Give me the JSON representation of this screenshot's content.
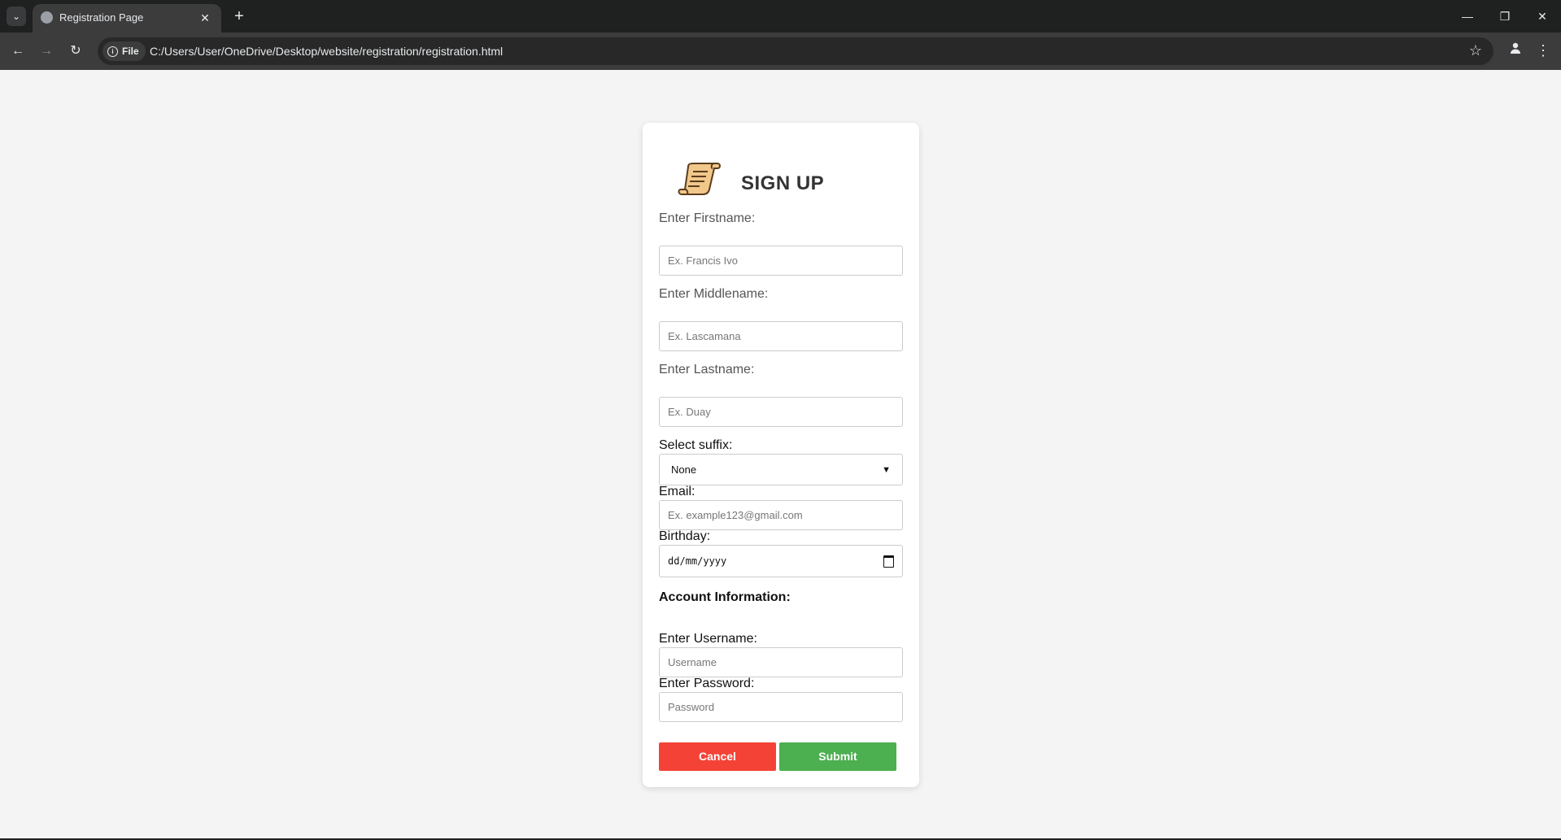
{
  "browser": {
    "tab_title": "Registration Page",
    "url": "C:/Users/User/OneDrive/Desktop/website/registration/registration.html",
    "site_chip_label": "File"
  },
  "form": {
    "heading": "SIGN UP",
    "firstname": {
      "label": "Enter Firstname:",
      "placeholder": "Ex. Francis Ivo"
    },
    "middlename": {
      "label": "Enter Middlename:",
      "placeholder": "Ex. Lascamana"
    },
    "lastname": {
      "label": "Enter Lastname:",
      "placeholder": "Ex. Duay"
    },
    "suffix": {
      "label": "Select suffix:",
      "selected": "None"
    },
    "email": {
      "label": "Email:",
      "placeholder": "Ex. example123@gmail.com"
    },
    "birthday": {
      "label": "Birthday:",
      "placeholder": "dd/mm/yyyy"
    },
    "account_section": "Account Information:",
    "username": {
      "label": "Enter Username:",
      "placeholder": "Username"
    },
    "password": {
      "label": "Enter Password:",
      "placeholder": "Password"
    },
    "cancel_label": "Cancel",
    "submit_label": "Submit"
  },
  "colors": {
    "cancel": "#f44336",
    "submit": "#4caf50",
    "page_bg": "#f4f4f4",
    "card_bg": "#ffffff"
  },
  "icons": {
    "logo": "scroll-icon",
    "tab_search": "chevron-down-icon",
    "favicon": "globe-icon",
    "info": "info-icon",
    "bookmark": "star-icon",
    "profile": "person-icon",
    "menu": "kebab-menu-icon"
  }
}
